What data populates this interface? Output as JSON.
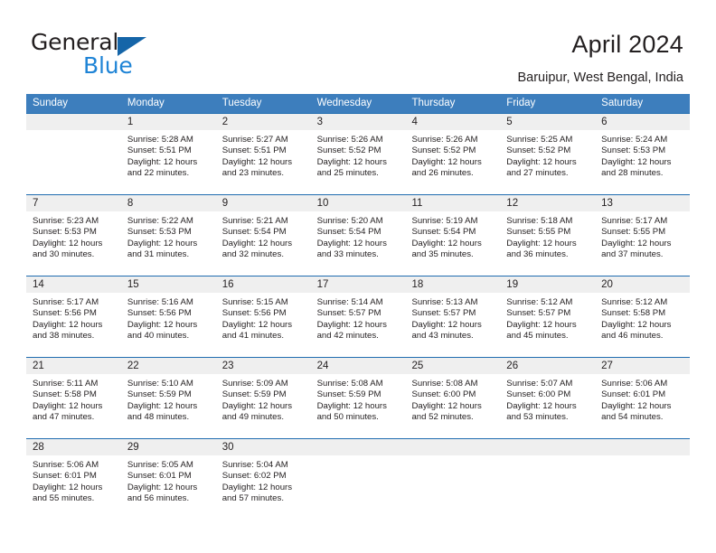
{
  "brand": {
    "name_part1": "General",
    "name_part2": "Blue",
    "triangle_color": "#1565a8",
    "blue_color": "#1f84d6"
  },
  "header": {
    "title": "April 2024",
    "subtitle": "Baruipur, West Bengal, India"
  },
  "theme": {
    "header_band": "#3d7ebd",
    "rule": "#1f6cb0",
    "daynum_band": "#efefef",
    "text": "#231f20"
  },
  "calendar": {
    "weekdays": [
      "Sunday",
      "Monday",
      "Tuesday",
      "Wednesday",
      "Thursday",
      "Friday",
      "Saturday"
    ],
    "weeks": [
      [
        {
          "day": "",
          "lines": []
        },
        {
          "day": "1",
          "lines": [
            "Sunrise: 5:28 AM",
            "Sunset: 5:51 PM",
            "Daylight: 12 hours",
            "and 22 minutes."
          ]
        },
        {
          "day": "2",
          "lines": [
            "Sunrise: 5:27 AM",
            "Sunset: 5:51 PM",
            "Daylight: 12 hours",
            "and 23 minutes."
          ]
        },
        {
          "day": "3",
          "lines": [
            "Sunrise: 5:26 AM",
            "Sunset: 5:52 PM",
            "Daylight: 12 hours",
            "and 25 minutes."
          ]
        },
        {
          "day": "4",
          "lines": [
            "Sunrise: 5:26 AM",
            "Sunset: 5:52 PM",
            "Daylight: 12 hours",
            "and 26 minutes."
          ]
        },
        {
          "day": "5",
          "lines": [
            "Sunrise: 5:25 AM",
            "Sunset: 5:52 PM",
            "Daylight: 12 hours",
            "and 27 minutes."
          ]
        },
        {
          "day": "6",
          "lines": [
            "Sunrise: 5:24 AM",
            "Sunset: 5:53 PM",
            "Daylight: 12 hours",
            "and 28 minutes."
          ]
        }
      ],
      [
        {
          "day": "7",
          "lines": [
            "Sunrise: 5:23 AM",
            "Sunset: 5:53 PM",
            "Daylight: 12 hours",
            "and 30 minutes."
          ]
        },
        {
          "day": "8",
          "lines": [
            "Sunrise: 5:22 AM",
            "Sunset: 5:53 PM",
            "Daylight: 12 hours",
            "and 31 minutes."
          ]
        },
        {
          "day": "9",
          "lines": [
            "Sunrise: 5:21 AM",
            "Sunset: 5:54 PM",
            "Daylight: 12 hours",
            "and 32 minutes."
          ]
        },
        {
          "day": "10",
          "lines": [
            "Sunrise: 5:20 AM",
            "Sunset: 5:54 PM",
            "Daylight: 12 hours",
            "and 33 minutes."
          ]
        },
        {
          "day": "11",
          "lines": [
            "Sunrise: 5:19 AM",
            "Sunset: 5:54 PM",
            "Daylight: 12 hours",
            "and 35 minutes."
          ]
        },
        {
          "day": "12",
          "lines": [
            "Sunrise: 5:18 AM",
            "Sunset: 5:55 PM",
            "Daylight: 12 hours",
            "and 36 minutes."
          ]
        },
        {
          "day": "13",
          "lines": [
            "Sunrise: 5:17 AM",
            "Sunset: 5:55 PM",
            "Daylight: 12 hours",
            "and 37 minutes."
          ]
        }
      ],
      [
        {
          "day": "14",
          "lines": [
            "Sunrise: 5:17 AM",
            "Sunset: 5:56 PM",
            "Daylight: 12 hours",
            "and 38 minutes."
          ]
        },
        {
          "day": "15",
          "lines": [
            "Sunrise: 5:16 AM",
            "Sunset: 5:56 PM",
            "Daylight: 12 hours",
            "and 40 minutes."
          ]
        },
        {
          "day": "16",
          "lines": [
            "Sunrise: 5:15 AM",
            "Sunset: 5:56 PM",
            "Daylight: 12 hours",
            "and 41 minutes."
          ]
        },
        {
          "day": "17",
          "lines": [
            "Sunrise: 5:14 AM",
            "Sunset: 5:57 PM",
            "Daylight: 12 hours",
            "and 42 minutes."
          ]
        },
        {
          "day": "18",
          "lines": [
            "Sunrise: 5:13 AM",
            "Sunset: 5:57 PM",
            "Daylight: 12 hours",
            "and 43 minutes."
          ]
        },
        {
          "day": "19",
          "lines": [
            "Sunrise: 5:12 AM",
            "Sunset: 5:57 PM",
            "Daylight: 12 hours",
            "and 45 minutes."
          ]
        },
        {
          "day": "20",
          "lines": [
            "Sunrise: 5:12 AM",
            "Sunset: 5:58 PM",
            "Daylight: 12 hours",
            "and 46 minutes."
          ]
        }
      ],
      [
        {
          "day": "21",
          "lines": [
            "Sunrise: 5:11 AM",
            "Sunset: 5:58 PM",
            "Daylight: 12 hours",
            "and 47 minutes."
          ]
        },
        {
          "day": "22",
          "lines": [
            "Sunrise: 5:10 AM",
            "Sunset: 5:59 PM",
            "Daylight: 12 hours",
            "and 48 minutes."
          ]
        },
        {
          "day": "23",
          "lines": [
            "Sunrise: 5:09 AM",
            "Sunset: 5:59 PM",
            "Daylight: 12 hours",
            "and 49 minutes."
          ]
        },
        {
          "day": "24",
          "lines": [
            "Sunrise: 5:08 AM",
            "Sunset: 5:59 PM",
            "Daylight: 12 hours",
            "and 50 minutes."
          ]
        },
        {
          "day": "25",
          "lines": [
            "Sunrise: 5:08 AM",
            "Sunset: 6:00 PM",
            "Daylight: 12 hours",
            "and 52 minutes."
          ]
        },
        {
          "day": "26",
          "lines": [
            "Sunrise: 5:07 AM",
            "Sunset: 6:00 PM",
            "Daylight: 12 hours",
            "and 53 minutes."
          ]
        },
        {
          "day": "27",
          "lines": [
            "Sunrise: 5:06 AM",
            "Sunset: 6:01 PM",
            "Daylight: 12 hours",
            "and 54 minutes."
          ]
        }
      ],
      [
        {
          "day": "28",
          "lines": [
            "Sunrise: 5:06 AM",
            "Sunset: 6:01 PM",
            "Daylight: 12 hours",
            "and 55 minutes."
          ]
        },
        {
          "day": "29",
          "lines": [
            "Sunrise: 5:05 AM",
            "Sunset: 6:01 PM",
            "Daylight: 12 hours",
            "and 56 minutes."
          ]
        },
        {
          "day": "30",
          "lines": [
            "Sunrise: 5:04 AM",
            "Sunset: 6:02 PM",
            "Daylight: 12 hours",
            "and 57 minutes."
          ]
        },
        {
          "day": "",
          "lines": []
        },
        {
          "day": "",
          "lines": []
        },
        {
          "day": "",
          "lines": []
        },
        {
          "day": "",
          "lines": []
        }
      ]
    ]
  }
}
